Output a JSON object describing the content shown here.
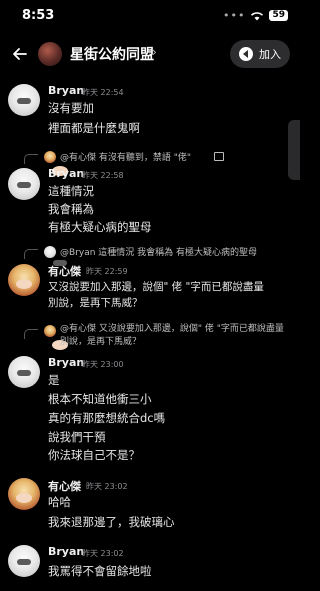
{
  "status_bar": {
    "time": "8:53",
    "signal": "•••",
    "battery": "59"
  },
  "header": {
    "title": "星街公約同盟",
    "chevron": "›",
    "join_label": "加入"
  },
  "messages": [
    {
      "author": "Bryan",
      "time": "昨天 22:54",
      "lines": [
        "沒有要加",
        "裡面都是什麼鬼啊"
      ]
    },
    {
      "reply_to": "@有心傑 有沒有聽到，禁語 \"佬\"",
      "author": "Bryan",
      "time": "昨天 22:58",
      "lines": [
        "這種情況",
        "我會稱為",
        "有極大疑心病的聖母"
      ]
    },
    {
      "reply_to": "@Bryan 這種情況 我會稱為 有極大疑心病的聖母",
      "author": "有心傑",
      "time": "昨天 22:59",
      "lines": [
        "又沒說要加入那邊，說個\" 佬 \"字而已都說盡量",
        "別說，是再下馬威？"
      ]
    },
    {
      "reply_to": "@有心傑 又沒說要加入那邊，說個\" 佬 \"字而已都說盡量別說，是再下馬威？",
      "author": "Bryan",
      "time": "昨天 23:00",
      "lines": [
        "是",
        "根本不知道他衝三小",
        "真的有那麼想統合dc嗎",
        "說我們干預",
        "你法球自己不是？"
      ]
    },
    {
      "author": "有心傑",
      "time": "昨天 23:02",
      "lines": [
        "哈哈",
        "我來退那邊了，我破璃心"
      ]
    },
    {
      "author": "Bryan",
      "time": "昨天 23:02",
      "lines": [
        "我罵得不會留餘地啦"
      ]
    }
  ]
}
